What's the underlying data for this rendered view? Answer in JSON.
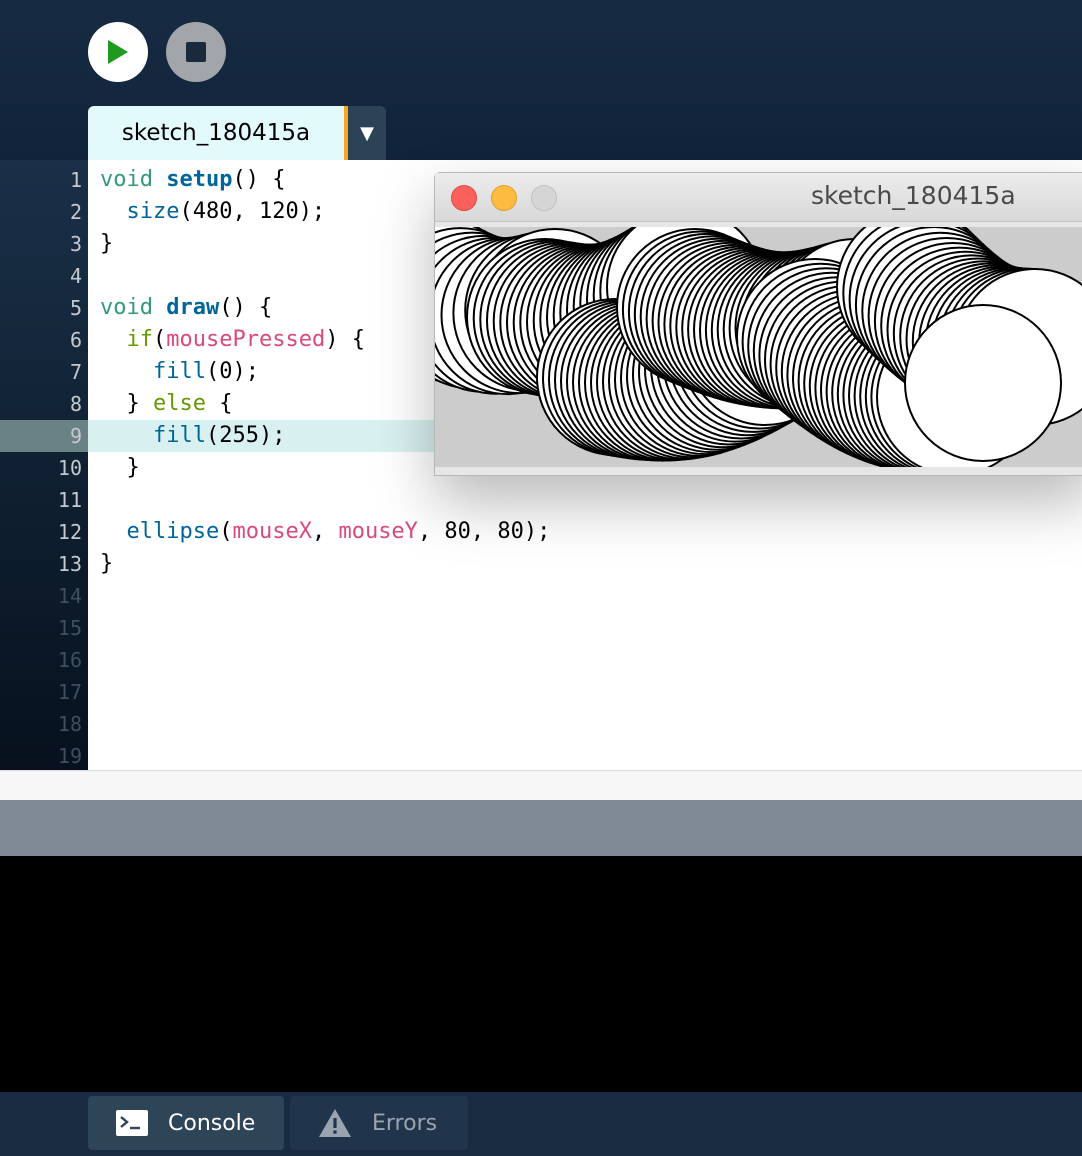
{
  "toolbar": {
    "run_icon": "play-icon",
    "stop_icon": "stop-icon"
  },
  "tab": {
    "label": "sketch_180415a",
    "menu_glyph": "▼"
  },
  "editor": {
    "current_line": 9,
    "line_numbers": [
      "1",
      "2",
      "3",
      "4",
      "5",
      "6",
      "7",
      "8",
      "9",
      "10",
      "11",
      "12",
      "13",
      "14",
      "15",
      "16",
      "17",
      "18",
      "19"
    ],
    "lines": [
      [
        [
          "void ",
          "k-void"
        ],
        [
          "setup",
          "k-fn"
        ],
        [
          "() {",
          ""
        ]
      ],
      [
        [
          "  ",
          ""
        ],
        [
          "size",
          "k-call"
        ],
        [
          "(480, 120);",
          ""
        ]
      ],
      [
        [
          "}",
          ""
        ]
      ],
      [],
      [
        [
          "void ",
          "k-void"
        ],
        [
          "draw",
          "k-fn"
        ],
        [
          "() {",
          ""
        ]
      ],
      [
        [
          "  ",
          ""
        ],
        [
          "if",
          "k-if"
        ],
        [
          "(",
          ""
        ],
        [
          "mousePressed",
          "k-var"
        ],
        [
          ") {",
          ""
        ]
      ],
      [
        [
          "    ",
          ""
        ],
        [
          "fill",
          "k-call"
        ],
        [
          "(0);",
          ""
        ]
      ],
      [
        [
          "  } ",
          ""
        ],
        [
          "else",
          "k-else"
        ],
        [
          " {",
          ""
        ]
      ],
      [
        [
          "    ",
          ""
        ],
        [
          "fill",
          "k-call"
        ],
        [
          "(255);",
          ""
        ]
      ],
      [
        [
          "  }",
          ""
        ]
      ],
      [],
      [
        [
          "  ",
          ""
        ],
        [
          "ellipse",
          "k-call"
        ],
        [
          "(",
          ""
        ],
        [
          "mouseX",
          "k-var"
        ],
        [
          ", ",
          ""
        ],
        [
          "mouseY",
          "k-var"
        ],
        [
          ", 80, 80);",
          ""
        ]
      ],
      [
        [
          "}",
          ""
        ]
      ],
      [],
      [],
      [],
      [],
      [],
      []
    ]
  },
  "sketch_window": {
    "title": "sketch_180415a"
  },
  "bottom_tabs": {
    "console": "Console",
    "errors": "Errors"
  }
}
